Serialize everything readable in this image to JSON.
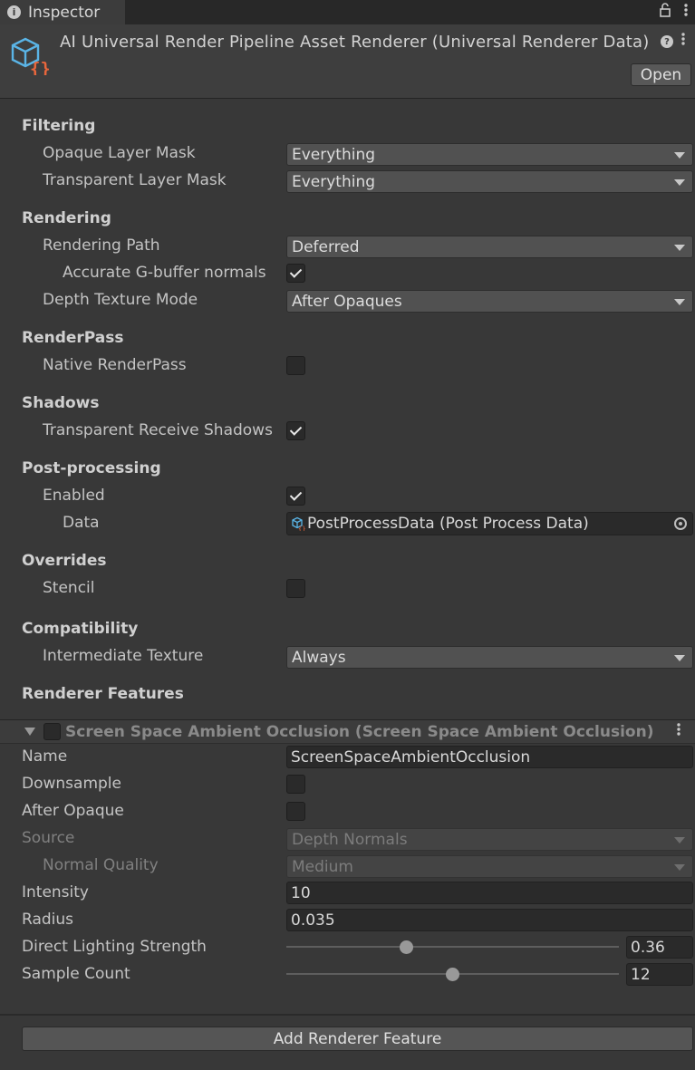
{
  "tab": {
    "label": "Inspector"
  },
  "header": {
    "title": "AI Universal Render Pipeline Asset Renderer (Universal Renderer Data)",
    "open_label": "Open"
  },
  "sections": {
    "filtering": "Filtering",
    "rendering": "Rendering",
    "renderpass": "RenderPass",
    "shadows": "Shadows",
    "postprocessing": "Post-processing",
    "overrides": "Overrides",
    "compatibility": "Compatibility",
    "renderer_features": "Renderer Features"
  },
  "filtering": {
    "opaque_label": "Opaque Layer Mask",
    "opaque_value": "Everything",
    "transparent_label": "Transparent Layer Mask",
    "transparent_value": "Everything"
  },
  "rendering": {
    "path_label": "Rendering Path",
    "path_value": "Deferred",
    "gbuffer_label": "Accurate G-buffer normals",
    "gbuffer_checked": true,
    "depth_label": "Depth Texture Mode",
    "depth_value": "After Opaques"
  },
  "renderpass": {
    "native_label": "Native RenderPass",
    "native_checked": false
  },
  "shadows": {
    "receive_label": "Transparent Receive Shadows",
    "receive_checked": true
  },
  "postprocessing": {
    "enabled_label": "Enabled",
    "enabled_checked": true,
    "data_label": "Data",
    "data_value": "PostProcessData (Post Process Data)"
  },
  "overrides": {
    "stencil_label": "Stencil",
    "stencil_checked": false
  },
  "compatibility": {
    "intermediate_label": "Intermediate Texture",
    "intermediate_value": "Always"
  },
  "feature": {
    "title": "Screen Space Ambient Occlusion (Screen Space Ambient Occlusion)",
    "enabled": false,
    "name_label": "Name",
    "name_value": "ScreenSpaceAmbientOcclusion",
    "downsample_label": "Downsample",
    "downsample_checked": false,
    "after_opaque_label": "After Opaque",
    "after_opaque_checked": false,
    "source_label": "Source",
    "source_value": "Depth Normals",
    "normal_quality_label": "Normal Quality",
    "normal_quality_value": "Medium",
    "intensity_label": "Intensity",
    "intensity_value": "10",
    "radius_label": "Radius",
    "radius_value": "0.035",
    "direct_lighting_label": "Direct Lighting Strength",
    "direct_lighting_value": "0.36",
    "direct_lighting_fraction": 0.36,
    "sample_count_label": "Sample Count",
    "sample_count_value": "12",
    "sample_count_fraction": 0.5
  },
  "add_feature_label": "Add Renderer Feature",
  "colors": {
    "panel_bg": "#383838",
    "header_bg": "#3e3e3e",
    "field_bg": "#2a2a2a",
    "dropdown_bg": "#515151"
  }
}
